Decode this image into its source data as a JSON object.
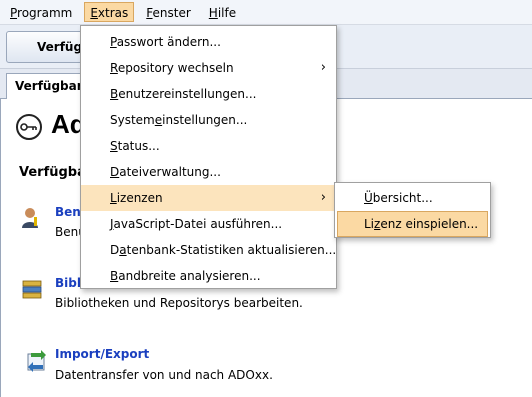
{
  "menubar": {
    "items": [
      {
        "label": "Programm",
        "mnemonic": "P",
        "rest": "rogramm"
      },
      {
        "label": "Extras",
        "mnemonic": "E",
        "rest": "xtras"
      },
      {
        "label": "Fenster",
        "mnemonic": "F",
        "rest": "enster"
      },
      {
        "label": "Hilfe",
        "mnemonic": "H",
        "rest": "ilfe"
      }
    ]
  },
  "toolbar": {
    "button_label": "Verfügbare"
  },
  "tabs": [
    {
      "label": "Verfügbare"
    }
  ],
  "main": {
    "title": "Ad",
    "section": "Verfügbar",
    "items": [
      {
        "title": "Benu",
        "desc": "Benu"
      },
      {
        "title": "Bibli",
        "desc": "Bibliotheken und Repositorys bearbeiten."
      },
      {
        "title": "Import/Export",
        "desc": "Datentransfer von und nach ADOxx."
      }
    ]
  },
  "extras_menu": {
    "items": [
      {
        "pre": "",
        "mn": "P",
        "post": "asswort ändern..."
      },
      {
        "pre": "",
        "mn": "R",
        "post": "epository wechseln",
        "arrow": "›"
      },
      {
        "pre": "",
        "mn": "B",
        "post": "enutzereinstellungen..."
      },
      {
        "pre": "System",
        "mn": "e",
        "post": "instellungen..."
      },
      {
        "pre": "",
        "mn": "S",
        "post": "tatus..."
      },
      {
        "pre": "",
        "mn": "D",
        "post": "ateiverwaltung..."
      },
      {
        "pre": "",
        "mn": "L",
        "post": "izenzen",
        "arrow": "›"
      },
      {
        "pre": "",
        "mn": "J",
        "post": "avaScript-Datei ausführen..."
      },
      {
        "pre": "D",
        "mn": "a",
        "post": "tenbank-Statistiken aktualisieren..."
      },
      {
        "pre": "",
        "mn": "B",
        "post": "andbreite analysieren..."
      }
    ]
  },
  "licenses_submenu": {
    "items": [
      {
        "pre": "",
        "mn": "Ü",
        "post": "bersicht..."
      },
      {
        "pre": "Li",
        "mn": "z",
        "post": "enz einspielen..."
      }
    ]
  },
  "colors": {
    "highlight": "#fce4bd",
    "active": "#fbd9a3",
    "link": "#1a3fbf"
  }
}
